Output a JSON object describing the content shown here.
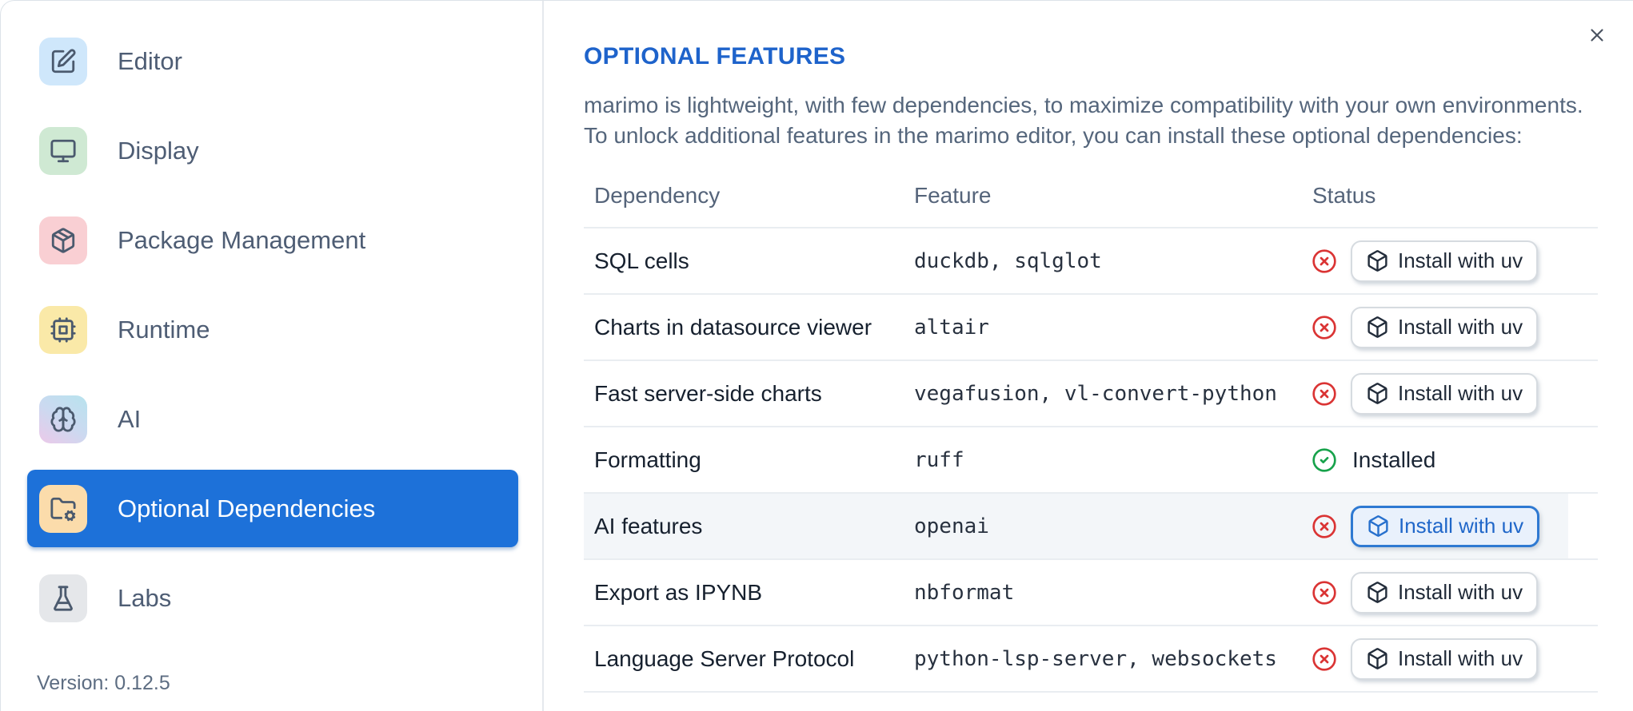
{
  "sidebar": {
    "items": [
      {
        "label": "Editor",
        "icon": "square-pen",
        "icon_bg": "#cfe7fb",
        "selected": false
      },
      {
        "label": "Display",
        "icon": "monitor",
        "icon_bg": "#cfe9d3",
        "selected": false
      },
      {
        "label": "Package Management",
        "icon": "package",
        "icon_bg": "#f9cfd3",
        "selected": false
      },
      {
        "label": "Runtime",
        "icon": "cpu",
        "icon_bg": "#fae9a8",
        "selected": false
      },
      {
        "label": "AI",
        "icon": "brain",
        "icon_bg": "linear-gradient(215deg,#b7e3ee 0%,#ccd9f0 52%,#ecc9e9 100%)",
        "selected": false
      },
      {
        "label": "Optional Dependencies",
        "icon": "folder-cog",
        "icon_bg": "#fbdcab",
        "selected": true
      },
      {
        "label": "Labs",
        "icon": "flask",
        "icon_bg": "#e5e7ea",
        "selected": false
      }
    ],
    "version_label": "Version: 0.12.5"
  },
  "panel": {
    "title": "OPTIONAL FEATURES",
    "description": "marimo is lightweight, with few dependencies, to maximize compatibility with your own environments.\nTo unlock additional features in the marimo editor, you can install these optional dependencies:",
    "close_icon": "x",
    "table": {
      "columns": [
        "Dependency",
        "Feature",
        "Status"
      ],
      "install_button_label": "Install with uv",
      "install_button_icon": "box",
      "installed_label": "Installed",
      "rows": [
        {
          "dependency": "SQL cells",
          "feature": "duckdb, sqlglot",
          "installed": false,
          "highlighted": false
        },
        {
          "dependency": "Charts in datasource viewer",
          "feature": "altair",
          "installed": false,
          "highlighted": false
        },
        {
          "dependency": "Fast server-side charts",
          "feature": "vegafusion, vl-convert-python",
          "installed": false,
          "highlighted": false
        },
        {
          "dependency": "Formatting",
          "feature": "ruff",
          "installed": true,
          "highlighted": false
        },
        {
          "dependency": "AI features",
          "feature": "openai",
          "installed": false,
          "highlighted": true
        },
        {
          "dependency": "Export as IPYNB",
          "feature": "nbformat",
          "installed": false,
          "highlighted": false
        },
        {
          "dependency": "Language Server Protocol",
          "feature": "python-lsp-server, websockets",
          "installed": false,
          "highlighted": false
        }
      ]
    },
    "colors": {
      "accent_blue": "#1d71d9",
      "title_blue": "#1e63cb",
      "error_red": "#da3434",
      "success_green": "#17a24b",
      "focused_button_border": "#2e79d2",
      "focused_button_bg": "#e9f1fc"
    }
  }
}
